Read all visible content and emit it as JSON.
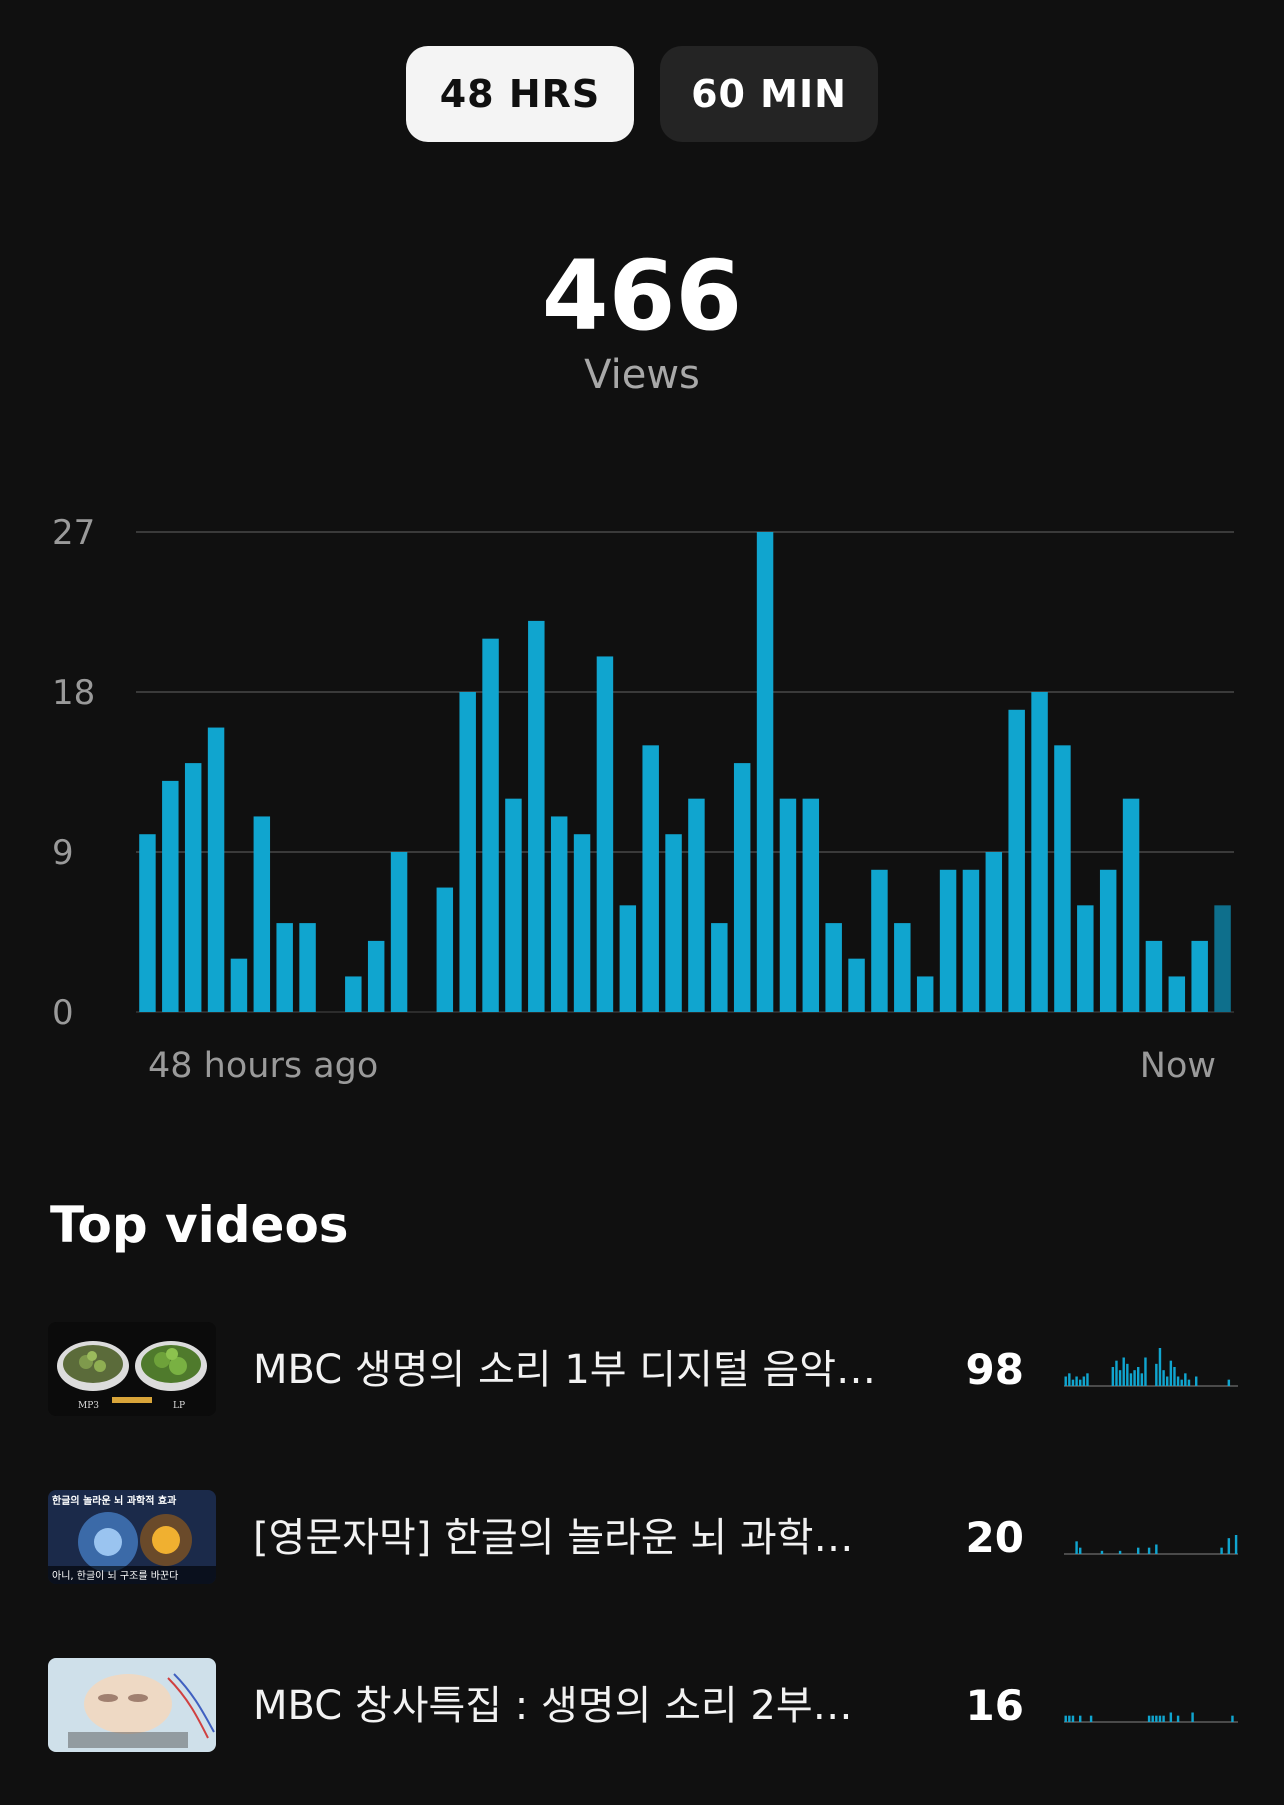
{
  "toggles": [
    {
      "label": "48 HRS",
      "active": true
    },
    {
      "label": "60 MIN",
      "active": false
    }
  ],
  "summary": {
    "value": "466",
    "label": "Views"
  },
  "colors": {
    "accent": "#10a5cf",
    "accent_last": "#0e6f8c",
    "background": "#101010",
    "grid": "#3a3a3a"
  },
  "chart_data": {
    "type": "bar",
    "ylim": [
      0,
      27
    ],
    "y_ticks": [
      "0",
      "9",
      "18",
      "27"
    ],
    "x_start_label": "48 hours ago",
    "x_end_label": "Now",
    "grid": true,
    "values": [
      10,
      13,
      14,
      16,
      3,
      11,
      5,
      5,
      0,
      2,
      4,
      9,
      0,
      7,
      18,
      21,
      12,
      22,
      11,
      10,
      20,
      6,
      15,
      10,
      12,
      5,
      14,
      27,
      12,
      12,
      5,
      3,
      8,
      5,
      2,
      8,
      8,
      9,
      17,
      18,
      15,
      6,
      8,
      12,
      4,
      2,
      4,
      6
    ],
    "last_bar_partial": true
  },
  "top_videos": {
    "title": "Top videos",
    "items": [
      {
        "title": "MBC 생명의 소리 1부 디지털 음악…",
        "views": "98",
        "thumb_labels": [
          "MP3",
          "LP"
        ],
        "spark": [
          3,
          4,
          2,
          3,
          2,
          3,
          4,
          0,
          0,
          0,
          0,
          0,
          0,
          6,
          8,
          5,
          9,
          7,
          4,
          5,
          6,
          4,
          9,
          0,
          0,
          7,
          12,
          5,
          3,
          8,
          6,
          3,
          2,
          4,
          2,
          0,
          3,
          0,
          0,
          0,
          0,
          0,
          0,
          0,
          0,
          2,
          0,
          0
        ]
      },
      {
        "title": "[영문자막] 한글의 놀라운 뇌 과학…",
        "views": "20",
        "thumb_labels": [
          "한글의 놀라운 뇌 과학적 효과",
          "아니, 한글이 뇌 구조를 바꾼다"
        ],
        "spark": [
          0,
          0,
          0,
          4,
          2,
          0,
          0,
          0,
          0,
          0,
          1,
          0,
          0,
          0,
          0,
          1,
          0,
          0,
          0,
          0,
          2,
          0,
          0,
          2,
          0,
          3,
          0,
          0,
          0,
          0,
          0,
          0,
          0,
          0,
          0,
          0,
          0,
          0,
          0,
          0,
          0,
          0,
          0,
          2,
          0,
          5,
          0,
          6
        ]
      },
      {
        "title": "MBC 창사특집 : 생명의 소리 2부…",
        "views": "16",
        "thumb_labels": [],
        "spark": [
          2,
          2,
          2,
          0,
          2,
          0,
          0,
          2,
          0,
          0,
          0,
          0,
          0,
          0,
          0,
          0,
          0,
          0,
          0,
          0,
          0,
          0,
          0,
          2,
          2,
          2,
          2,
          2,
          0,
          3,
          0,
          2,
          0,
          0,
          0,
          3,
          0,
          0,
          0,
          0,
          0,
          0,
          0,
          0,
          0,
          0,
          2,
          0
        ]
      }
    ]
  }
}
